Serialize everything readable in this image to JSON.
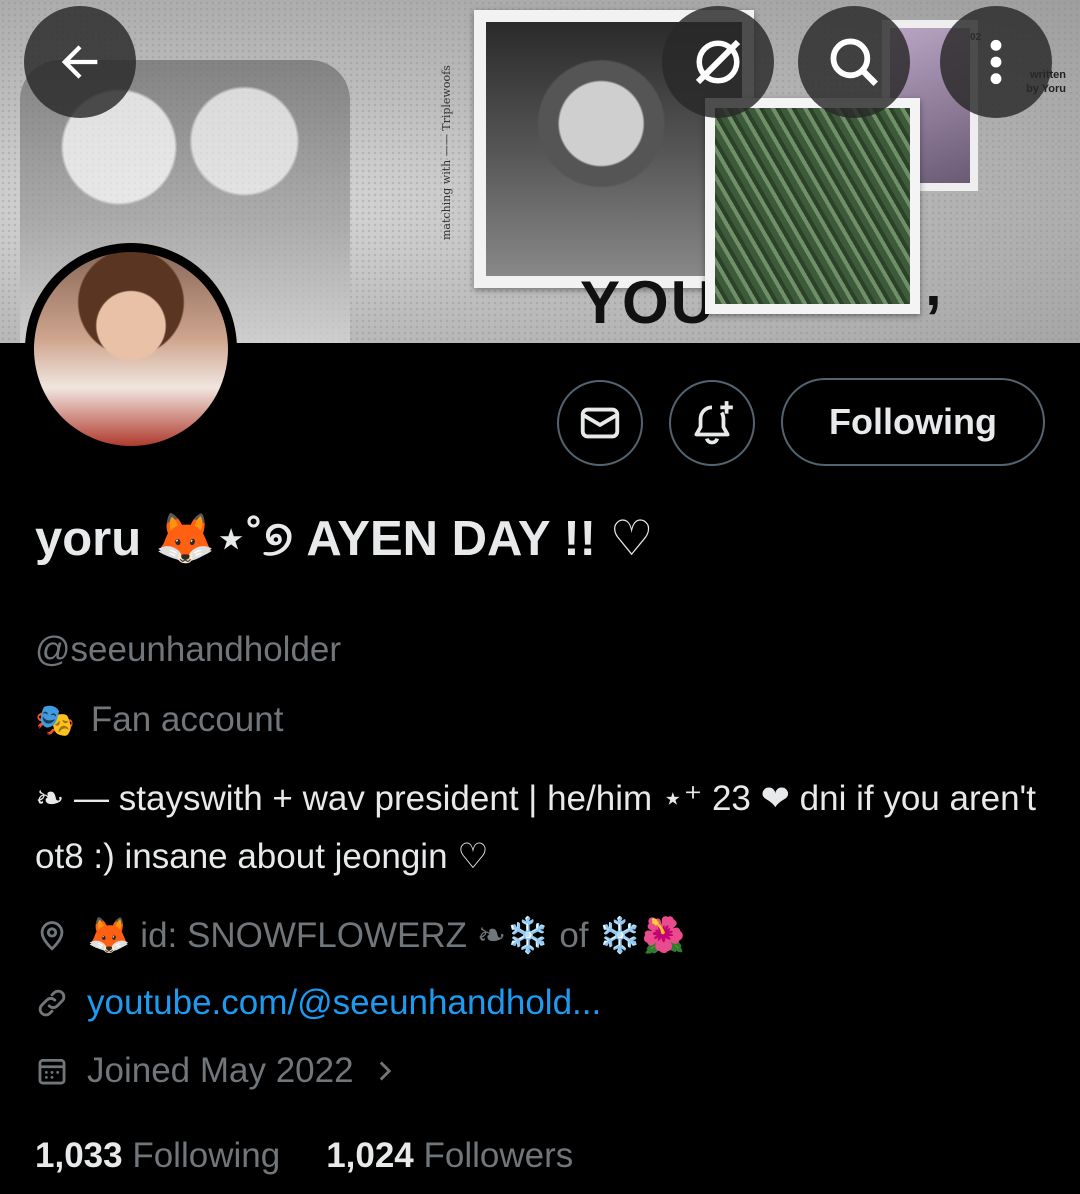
{
  "banner": {
    "vertical_text": "matching with —— Triplewoofs",
    "big_text": "YOU",
    "comma": ",",
    "num": "02",
    "written_line1": "written",
    "written_line2": "by Yoru"
  },
  "header_icons": [
    "back-arrow-icon",
    "grok-icon",
    "search-icon",
    "more-vertical-icon"
  ],
  "profile": {
    "display_name": "yoru 🦊⋆˚୭ AYEN DAY !! ♡",
    "handle": "@seeunhandholder",
    "category": "Fan account",
    "bio": "❧ — stayswith + wav president | he/him ⋆⁺ 23 ❤ dni if you aren't ot8 :) insane about jeongin ♡",
    "location": "🦊 id: SNOWFLOWERZ ❧❄️ of ❄️🌺",
    "website": "youtube.com/@seeunhandhold...",
    "joined": "Joined May 2022",
    "following_button": "Following"
  },
  "stats": {
    "following_count": "1,033",
    "following_label": "Following",
    "followers_count": "1,024",
    "followers_label": "Followers"
  },
  "colors": {
    "background": "#000000",
    "text": "#e7e9ea",
    "secondary": "#71767b",
    "link": "#1d9bf0",
    "border": "#536471"
  }
}
